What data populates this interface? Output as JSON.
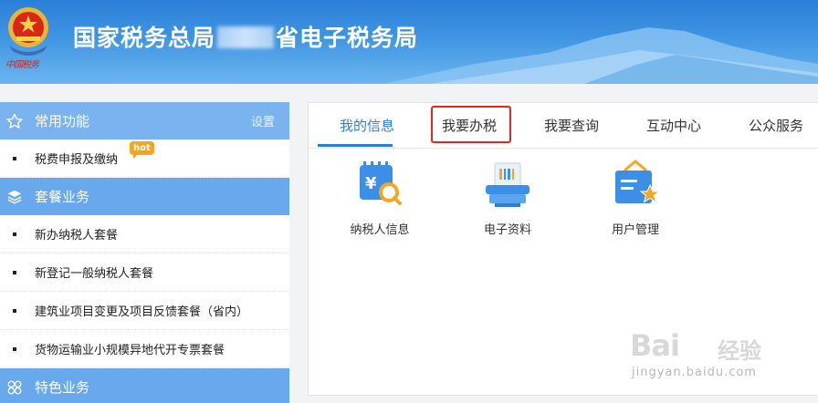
{
  "header": {
    "title_prefix": "国家税务总局",
    "title_suffix": "省电子税务局",
    "emblem_sub": "中国税务",
    "colors": {
      "band_top": "#2a7fd6",
      "band_bottom": "#6db5ef",
      "emblem_red": "#d8261b"
    }
  },
  "sidebar": {
    "sections": [
      {
        "title": "常用功能",
        "icon": "star-icon",
        "right_label": "设置"
      },
      {
        "title": "套餐业务",
        "icon": "layers-icon"
      },
      {
        "title": "特色业务",
        "icon": "clover-icon"
      }
    ],
    "common_items": [
      {
        "label": "税费申报及缴纳",
        "badge": "hot"
      }
    ],
    "package_items": [
      {
        "label": "新办纳税人套餐"
      },
      {
        "label": "新登记一般纳税人套餐"
      },
      {
        "label": "建筑业项目变更及项目反馈套餐（省内）"
      },
      {
        "label": "货物运输业小规模异地代开专票套餐"
      }
    ]
  },
  "main": {
    "tabs": [
      {
        "label": "我的信息",
        "active": true
      },
      {
        "label": "我要办税",
        "highlighted": true
      },
      {
        "label": "我要查询"
      },
      {
        "label": "互动中心"
      },
      {
        "label": "公众服务"
      }
    ],
    "tiles": [
      {
        "label": "纳税人信息",
        "icon": "taxpayer-info-icon"
      },
      {
        "label": "电子资料",
        "icon": "electronic-documents-icon"
      },
      {
        "label": "用户管理",
        "icon": "user-management-icon"
      }
    ],
    "colors": {
      "accent": "#2d7ed6",
      "highlight_box": "#e5261f"
    }
  },
  "watermark": {
    "brand": "Bai",
    "brand_cn": "经验",
    "url": "jingyan.baidu.com"
  }
}
